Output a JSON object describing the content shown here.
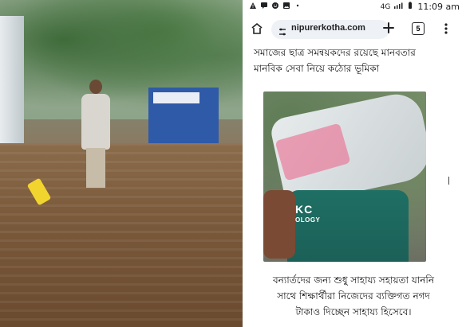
{
  "layout": {
    "left_photo_alt": "",
    "right_panel": "phone-browser"
  },
  "status_bar": {
    "icons": [
      "warning-icon",
      "message-icon",
      "face-icon",
      "image-icon",
      "dot-icon"
    ],
    "signal": "4G",
    "time": "11:09 am"
  },
  "browser": {
    "url": "nipurerkotha.com",
    "tabs_count": "5"
  },
  "article": {
    "headline_line1": "সমাজের ছাত্র সমন্বয়কদের রয়েছে মানবতার",
    "headline_line2": "মানবিক সেবা নিয়ে  কঠোর ভূমিকা",
    "photo_logo": "KC",
    "photo_logo_small": "OLOGY",
    "caption_line1": "বন্যার্তদের জন্য শুধু সাহায্য সহায়তা যাননি",
    "caption_line2": "সাথে শিক্ষার্থীরা নিজেদের ব্যক্তিগত নগদ",
    "caption_line3": "টাকাও দিচ্ছেন সাহায্য হিসেবে।"
  },
  "colors": {
    "address_bar_bg": "#eef2f6",
    "text": "#111111"
  }
}
